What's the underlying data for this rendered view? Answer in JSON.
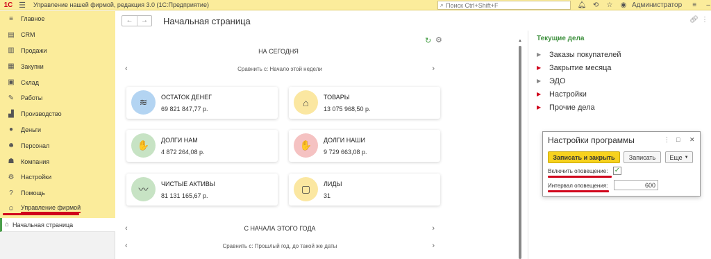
{
  "titlebar": {
    "logo": "1С",
    "title": "Управление нашей фирмой, редакция 3.0  (1С:Предприятие)",
    "search_placeholder": "Поиск Ctrl+Shift+F",
    "user": "Администратор"
  },
  "sidebar": {
    "items": [
      {
        "label": "Главное",
        "icon": "menu-icon"
      },
      {
        "label": "CRM",
        "icon": "crm-icon"
      },
      {
        "label": "Продажи",
        "icon": "sales-icon"
      },
      {
        "label": "Закупки",
        "icon": "purchases-icon"
      },
      {
        "label": "Склад",
        "icon": "warehouse-icon"
      },
      {
        "label": "Работы",
        "icon": "works-icon"
      },
      {
        "label": "Производство",
        "icon": "production-icon"
      },
      {
        "label": "Деньги",
        "icon": "money-icon"
      },
      {
        "label": "Персонал",
        "icon": "staff-icon"
      },
      {
        "label": "Компания",
        "icon": "company-icon"
      },
      {
        "label": "Настройки",
        "icon": "settings-icon"
      },
      {
        "label": "Помощь",
        "icon": "help-icon"
      },
      {
        "label": "Управление фирмой",
        "icon": "firm-icon"
      }
    ],
    "open_tab": "Начальная страница"
  },
  "main": {
    "page_title": "Начальная страница",
    "today_title": "НА СЕГОДНЯ",
    "today_compare": "Сравнить с: Начало этой недели",
    "cards": [
      {
        "title": "ОСТАТОК ДЕНЕГ",
        "value": "69 821 847,77 р.",
        "icon": "money-stack-icon",
        "color": "#b3d4f2"
      },
      {
        "title": "ТОВАРЫ",
        "value": "13 075 968,50 р.",
        "icon": "tag-icon",
        "color": "#fbe7a1"
      },
      {
        "title": "ДОЛГИ НАМ",
        "value": "4 872 264,08 р.",
        "icon": "hand-coin-icon",
        "color": "#c7e3c4"
      },
      {
        "title": "ДОЛГИ НАШИ",
        "value": "9 729 663,08 р.",
        "icon": "hand-coin-icon",
        "color": "#f5c2c2"
      },
      {
        "title": "ЧИСТЫЕ АКТИВЫ",
        "value": "81 131 165,67 р.",
        "icon": "trend-icon",
        "color": "#c7e3c4"
      },
      {
        "title": "ЛИДЫ",
        "value": "31",
        "icon": "lead-card-icon",
        "color": "#fbe7a1"
      }
    ],
    "year_title": "С НАЧАЛА ЭТОГО ГОДА",
    "year_compare": "Сравнить с: Прошлый год, до такой же даты"
  },
  "tasks": {
    "title": "Текущие дела",
    "items": [
      {
        "label": "Заказы покупателей",
        "marker": "gray"
      },
      {
        "label": "Закрытие месяца",
        "marker": "red"
      },
      {
        "label": "ЭДО",
        "marker": "gray"
      },
      {
        "label": "Настройки",
        "marker": "red"
      },
      {
        "label": "Прочие дела",
        "marker": "red"
      }
    ]
  },
  "settings_window": {
    "title": "Настройки программы",
    "save_close": "Записать и закрыть",
    "save": "Записать",
    "more": "Еще",
    "notify_label": "Включить оповещение:",
    "notify_checked": true,
    "interval_label": "Интервал оповещения:",
    "interval_value": "600"
  }
}
